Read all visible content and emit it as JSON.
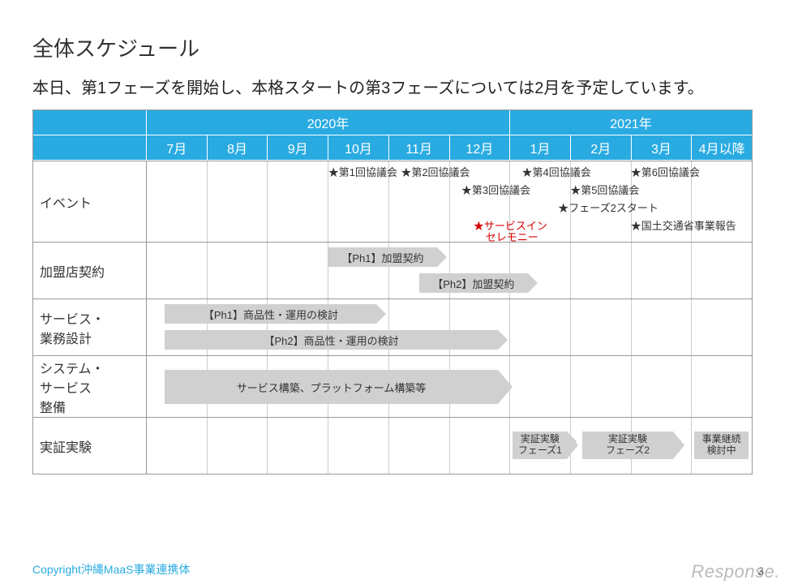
{
  "title": "全体スケジュール",
  "subtitle": "本日、第1フェーズを開始し、本格スタートの第3フェーズについては2月を予定しています。",
  "years": {
    "y2020": "2020年",
    "y2021": "2021年"
  },
  "months": [
    "7月",
    "8月",
    "9月",
    "10月",
    "11月",
    "12月",
    "1月",
    "2月",
    "3月",
    "4月以降"
  ],
  "rows": {
    "event": "イベント",
    "merchant": "加盟店契約",
    "service_design": "サービス・\n業務設計",
    "system": "システム・\nサービス\n整備",
    "experiment": "実証実験"
  },
  "events": {
    "m1": "★第1回協議会",
    "m2": "★第2回協議会",
    "m3": "★第3回協議会",
    "m4": "★第4回協議会",
    "m5": "★第5回協議会",
    "m6": "★第6回協議会",
    "phase2": "★フェーズ2スタート",
    "cer1": "★サービスイン",
    "cer2": "セレモニー",
    "report": "★国土交通省事業報告"
  },
  "bars": {
    "ph1c": "【Ph1】加盟契約",
    "ph2c": "【Ph2】加盟契約",
    "ph1d": "【Ph1】商品性・運用の検討",
    "ph2d": "【Ph2】商品性・運用の検討",
    "build": "サービス構築、プラットフォーム構築等",
    "ex1a": "実証実験",
    "ex1b": "フェーズ1",
    "ex2a": "実証実験",
    "ex2b": "フェーズ2",
    "ex3a": "事業継続",
    "ex3b": "検討中"
  },
  "footer": "Copyright沖縄MaaS事業連携体",
  "watermark": "Response.",
  "page": "3",
  "chart_data": {
    "type": "table",
    "title": "全体スケジュール",
    "timeline": {
      "start": "2020-07",
      "end": "2021-04+",
      "columns": [
        "2020/7",
        "2020/8",
        "2020/9",
        "2020/10",
        "2020/11",
        "2020/12",
        "2021/1",
        "2021/2",
        "2021/3",
        "2021/4以降"
      ]
    },
    "rows": [
      {
        "name": "イベント",
        "items": [
          {
            "label": "第1回協議会",
            "col": 3
          },
          {
            "label": "第2回協議会",
            "col": 4
          },
          {
            "label": "第3回協議会",
            "col": 5
          },
          {
            "label": "第4回協議会",
            "col": 6
          },
          {
            "label": "第5回協議会",
            "col": 7
          },
          {
            "label": "第6回協議会",
            "col": 8
          },
          {
            "label": "フェーズ2スタート",
            "col": 7
          },
          {
            "label": "サービスインセレモニー",
            "col": 5.5,
            "highlight": true
          },
          {
            "label": "国土交通省事業報告",
            "col": 8
          }
        ]
      },
      {
        "name": "加盟店契約",
        "bars": [
          {
            "label": "【Ph1】加盟契約",
            "start": 3,
            "end": 5
          },
          {
            "label": "【Ph2】加盟契約",
            "start": 4.5,
            "end": 6.5
          }
        ]
      },
      {
        "name": "サービス・業務設計",
        "bars": [
          {
            "label": "【Ph1】商品性・運用の検討",
            "start": 0.3,
            "end": 4
          },
          {
            "label": "【Ph2】商品性・運用の検討",
            "start": 0.3,
            "end": 6
          }
        ]
      },
      {
        "name": "システム・サービス整備",
        "bars": [
          {
            "label": "サービス構築、プラットフォーム構築等",
            "start": 0.3,
            "end": 6
          }
        ]
      },
      {
        "name": "実証実験",
        "bars": [
          {
            "label": "実証実験フェーズ1",
            "start": 6,
            "end": 7
          },
          {
            "label": "実証実験フェーズ2",
            "start": 7.2,
            "end": 8.8
          },
          {
            "label": "事業継続検討中",
            "start": 9,
            "end": 10,
            "arrow": false
          }
        ]
      }
    ]
  }
}
